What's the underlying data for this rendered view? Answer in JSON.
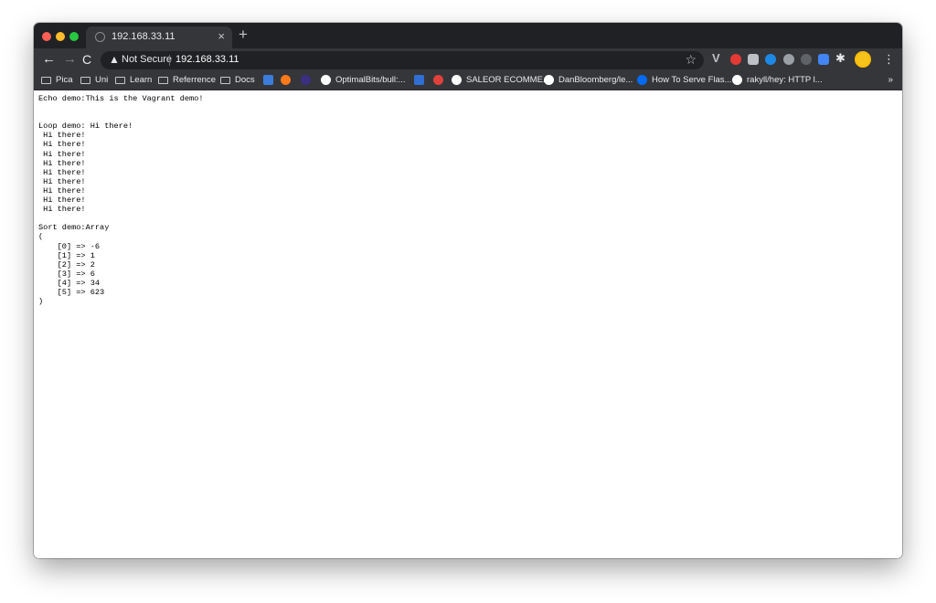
{
  "browser": {
    "tab_title": "192.168.33.11",
    "tab_close": "×",
    "new_tab": "+",
    "security_label": "Not Secure",
    "url": "192.168.33.11",
    "ext_v": "V",
    "menu": "⋮",
    "bookmarks_overflow": "»"
  },
  "bookmarks": [
    {
      "label": "Pica",
      "icon": "folder-icon"
    },
    {
      "label": "Uni",
      "icon": "folder-icon"
    },
    {
      "label": "Learn",
      "icon": "folder-icon"
    },
    {
      "label": "Referrence",
      "icon": "folder-icon"
    },
    {
      "label": "Docs",
      "icon": "folder-icon"
    },
    {
      "label": "OptimalBits/bull:...",
      "icon": "github-icon"
    },
    {
      "label": "SALEOR ECOMME...",
      "icon": "github-icon"
    },
    {
      "label": "DanBloomberg/le...",
      "icon": "github-icon"
    },
    {
      "label": "How To Serve Flas...",
      "icon": "do-icon"
    },
    {
      "label": "rakyll/hey: HTTP l...",
      "icon": "github-icon"
    }
  ],
  "page": {
    "echo_line": "Echo demo:This is the Vagrant demo!",
    "loop_header": "Loop demo: Hi there!",
    "loop_lines": [
      " Hi there!",
      " Hi there!",
      " Hi there!",
      " Hi there!",
      " Hi there!",
      " Hi there!",
      " Hi there!",
      " Hi there!",
      " Hi there!"
    ],
    "sort_header": "Sort demo:Array",
    "open_paren": "(",
    "sort_items": [
      "    [0] => -6",
      "    [1] => 1",
      "    [2] => 2",
      "    [3] => 6",
      "    [4] => 34",
      "    [5] => 623"
    ],
    "close_paren": ")"
  }
}
